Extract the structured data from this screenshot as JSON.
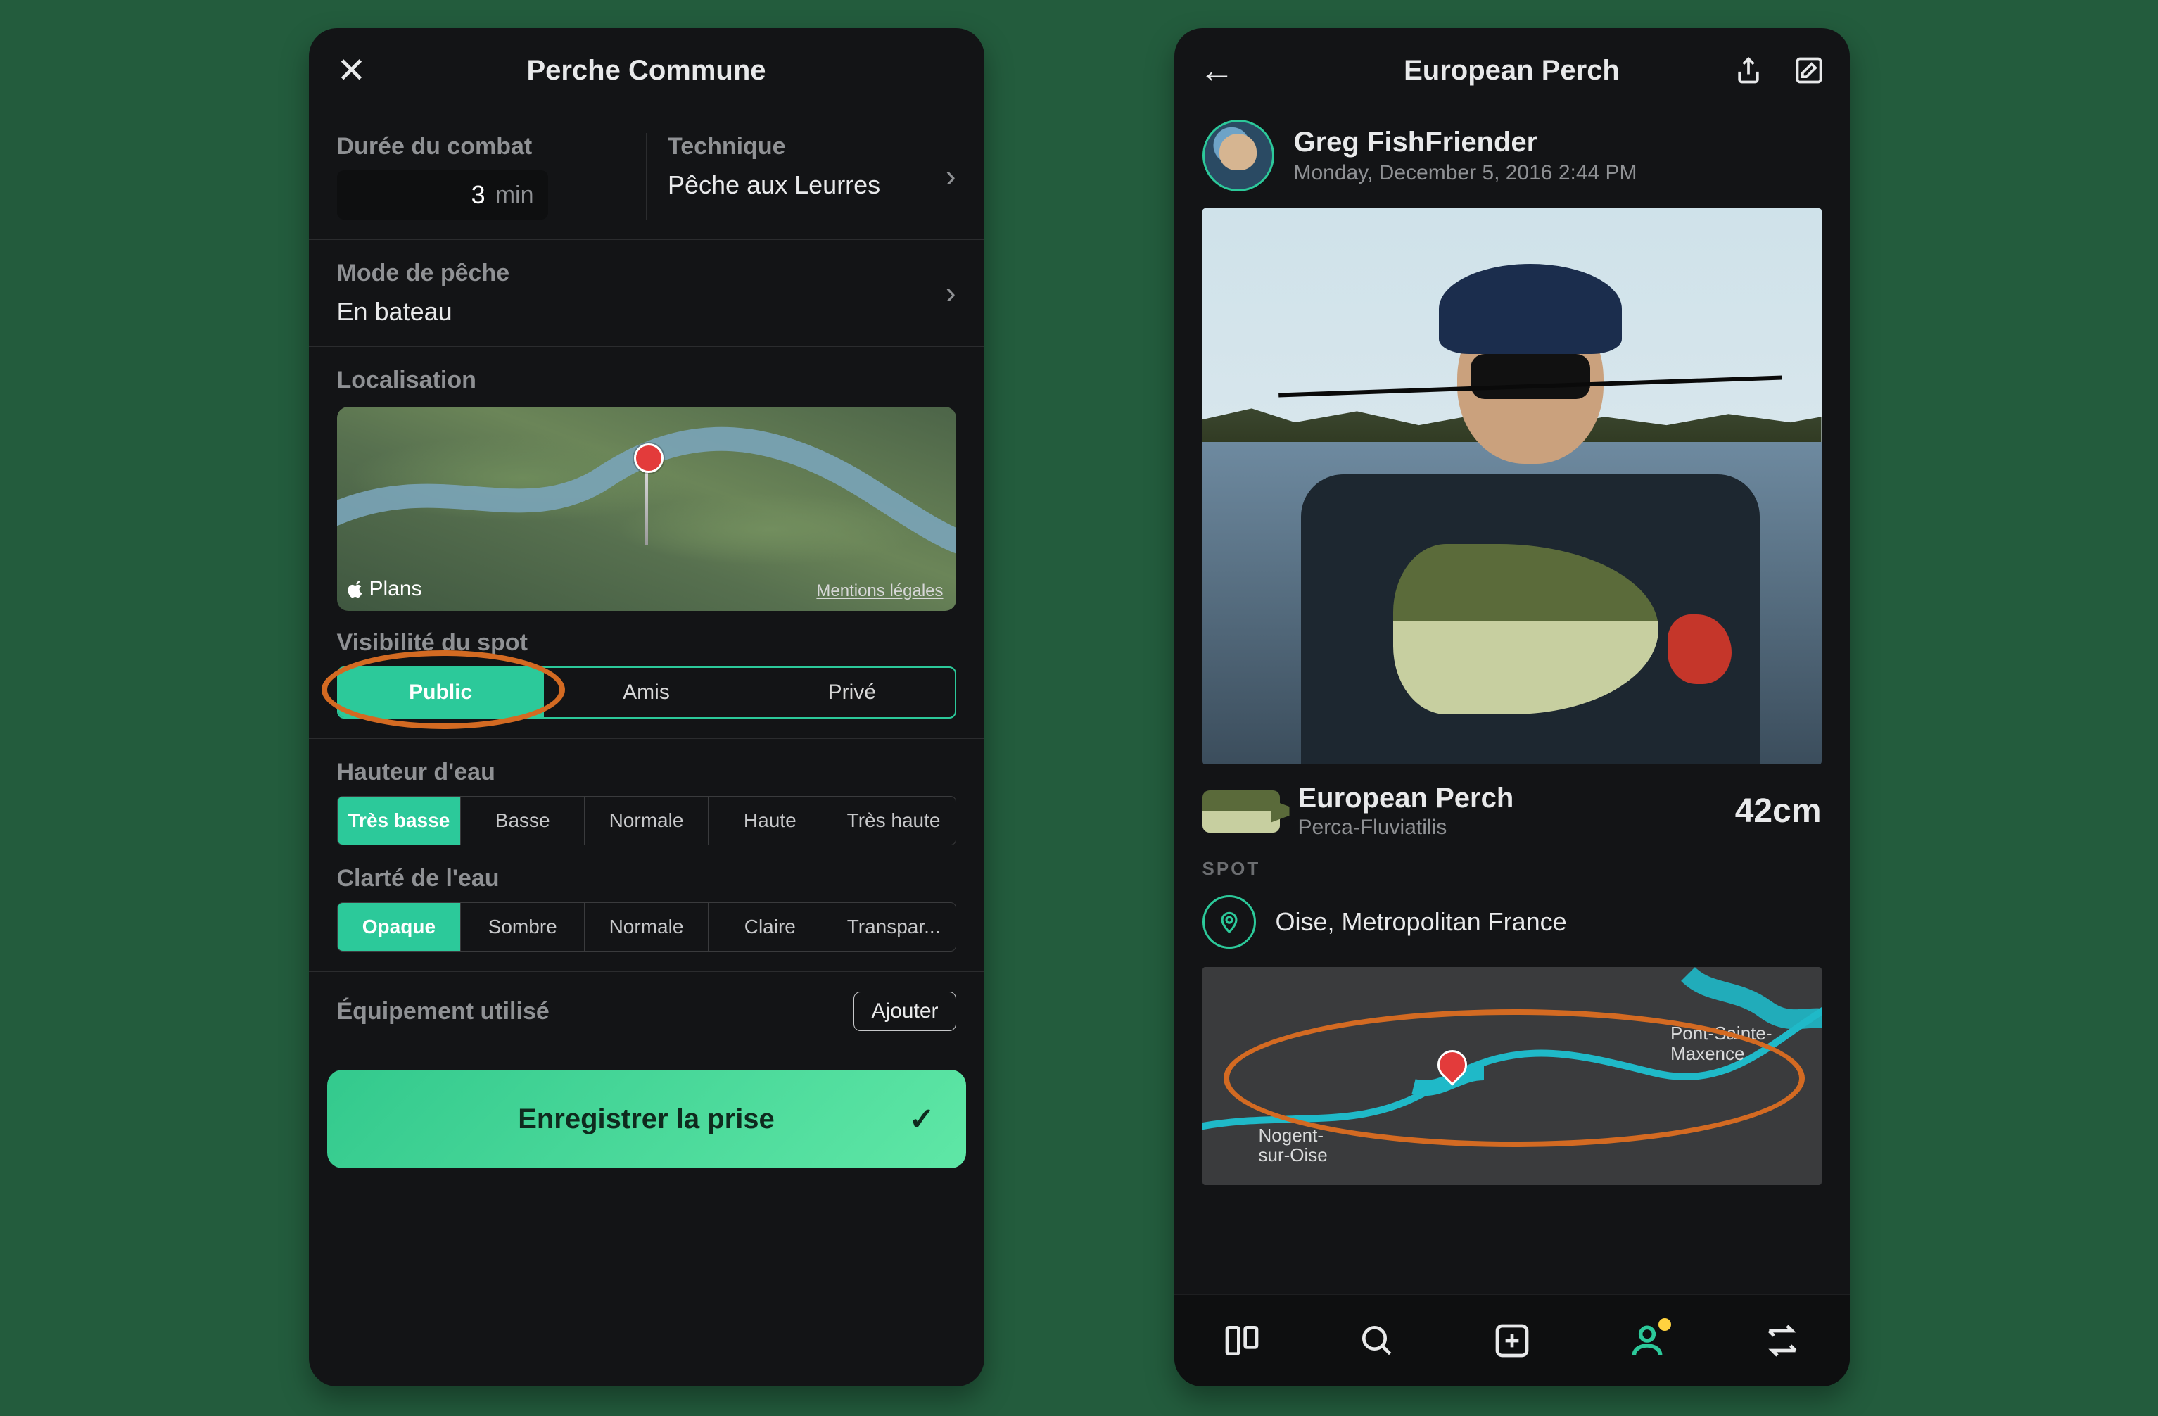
{
  "left": {
    "title": "Perche Commune",
    "duration": {
      "label": "Durée du combat",
      "value": "3",
      "unit": "min"
    },
    "technique": {
      "label": "Technique",
      "value": "Pêche aux Leurres"
    },
    "mode": {
      "label": "Mode de pêche",
      "value": "En bateau"
    },
    "location": {
      "label": "Localisation",
      "provider": "Plans",
      "legal": "Mentions légales"
    },
    "visibility": {
      "label": "Visibilité du spot",
      "options": [
        "Public",
        "Amis",
        "Privé"
      ],
      "selected": 0
    },
    "waterHeight": {
      "label": "Hauteur d'eau",
      "options": [
        "Très basse",
        "Basse",
        "Normale",
        "Haute",
        "Très haute"
      ],
      "selected": 0
    },
    "clarity": {
      "label": "Clarté de l'eau",
      "options": [
        "Opaque",
        "Sombre",
        "Normale",
        "Claire",
        "Transpar..."
      ],
      "selected": 0
    },
    "equipment": {
      "label": "Équipement utilisé",
      "add": "Ajouter"
    },
    "save": "Enregistrer la prise"
  },
  "right": {
    "title": "European Perch",
    "user": {
      "name": "Greg FishFriender",
      "date": "Monday, December 5, 2016 2:44 PM"
    },
    "species": {
      "name": "European Perch",
      "latin": "Perca-Fluviatilis",
      "size": "42cm"
    },
    "spot": {
      "label": "SPOT",
      "name": "Oise, Metropolitan France"
    },
    "mapLabels": {
      "town1a": "Pont-Sainte-",
      "town1b": "Maxence",
      "town2a": "Nogent-",
      "town2b": "sur-Oise"
    }
  }
}
